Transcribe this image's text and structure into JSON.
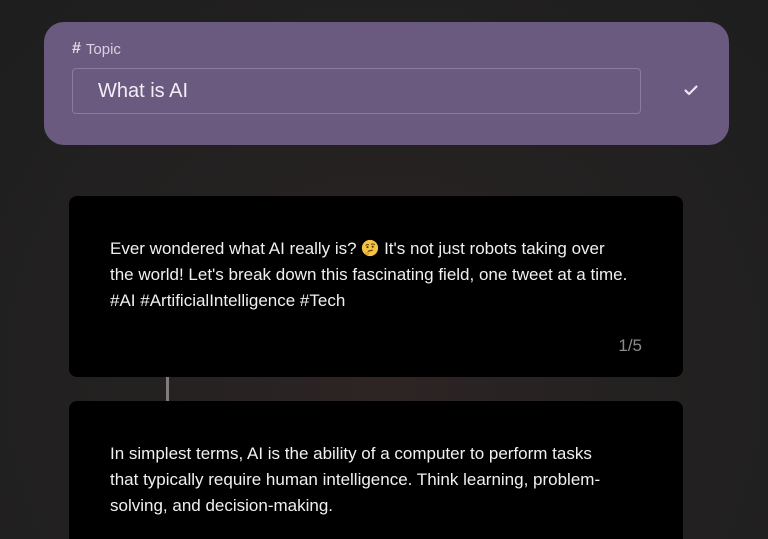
{
  "topic": {
    "label": "Topic",
    "icon": "hash-icon",
    "value": "What is AI",
    "confirm_icon": "check-icon"
  },
  "thread": [
    {
      "text_before_emoji": "Ever wondered what AI really is? ",
      "emoji": "thinking-face-emoji",
      "text_after_emoji": " It's not just robots taking over\nthe world! Let's break down this fascinating field, one tweet at a time.\n#AI #ArtificialIntelligence #Tech",
      "counter": "1/5"
    },
    {
      "text": "In simplest terms, AI is the ability of a computer to perform tasks\nthat typically require human intelligence. Think learning, problem-\nsolving, and decision-making."
    }
  ],
  "colors": {
    "topic_card": "#6a5a7f",
    "tweet_card": "#000000",
    "connector": "#7d7d7d"
  }
}
